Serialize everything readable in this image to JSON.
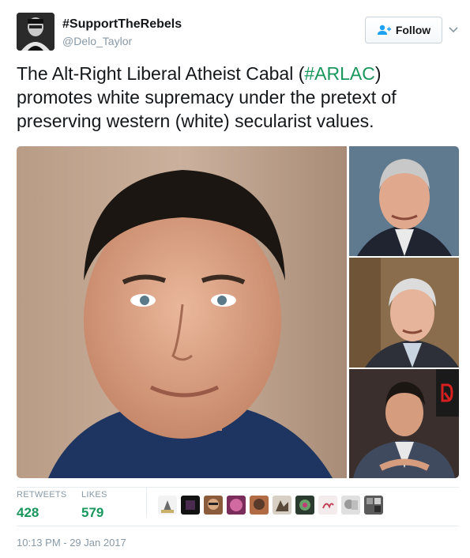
{
  "account": {
    "display_name": "#SupportTheRebels",
    "handle": "@Delo_Taylor"
  },
  "follow_button": {
    "label": "Follow"
  },
  "tweet": {
    "text_before": "The Alt-Right Liberal Atheist Cabal (",
    "hashtag": "#ARLAC",
    "text_after": ") promotes white supremacy under the pretext of preserving western (white) secularist values."
  },
  "stats": {
    "retweets_label": "RETWEETS",
    "retweets_count": "428",
    "likes_label": "LIKES",
    "likes_count": "579"
  },
  "timestamp": "10:13 PM - 29 Jan 2017",
  "colors": {
    "accent_green": "#19975d",
    "muted_text": "#8899a6",
    "divider": "#e6ecf0"
  },
  "icons": {
    "follow": "person-plus-icon",
    "menu": "chevron-down-icon"
  }
}
